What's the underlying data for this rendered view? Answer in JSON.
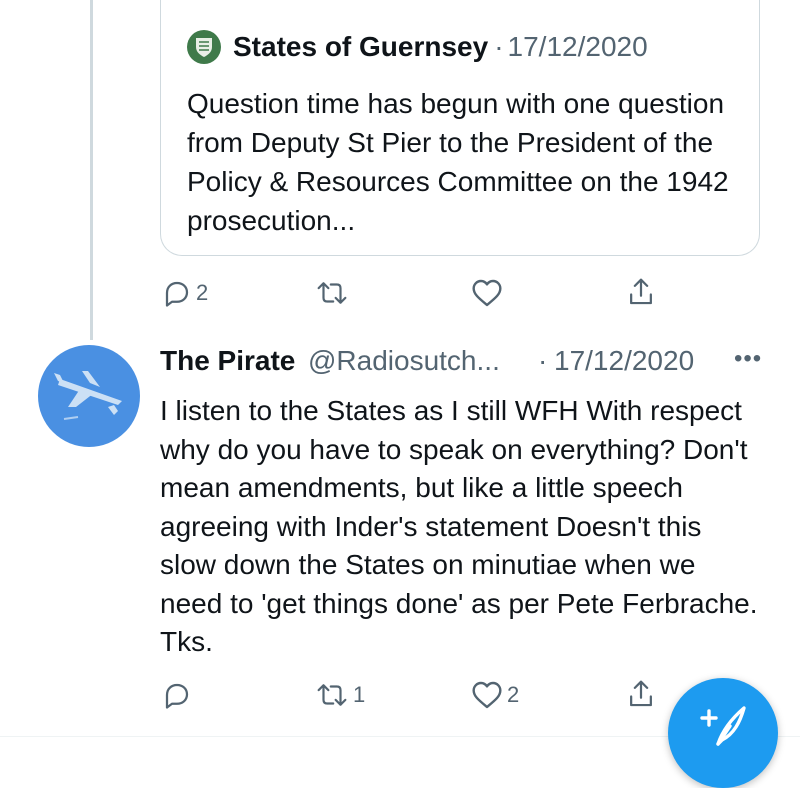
{
  "quoted_tweet": {
    "author": "States of Guernsey",
    "separator": "·",
    "date": "17/12/2020",
    "text": "Question time has begun with one question from Deputy St Pier to the President of the Policy & Resources Committee on the 1942 prosecution...",
    "avatar_icon": "guernsey-crest-icon",
    "avatar_color": "#3f7a4a"
  },
  "quoted_actions": {
    "reply_count": "2",
    "retweet_count": "",
    "like_count": ""
  },
  "tweet": {
    "author": "The Pirate",
    "handle": "@Radiosutch...",
    "separator": "·",
    "date": "17/12/2020",
    "more_label": "•••",
    "text": "I listen to the States as I still WFH With respect why do you have to speak on everything? Don't mean amendments, but like a little speech agreeing with  Inder's statement Doesn't this slow down the States on minutiae  when we need to 'get things done' as per Pete Ferbrache. Tks.",
    "avatar_icon": "airplane-icon",
    "avatar_color": "#4a90e2"
  },
  "tweet_actions": {
    "reply_count": "",
    "retweet_count": "1",
    "like_count": "2"
  },
  "compose_button": {
    "icon": "compose-tweet-icon",
    "color": "#1d9bf0"
  }
}
